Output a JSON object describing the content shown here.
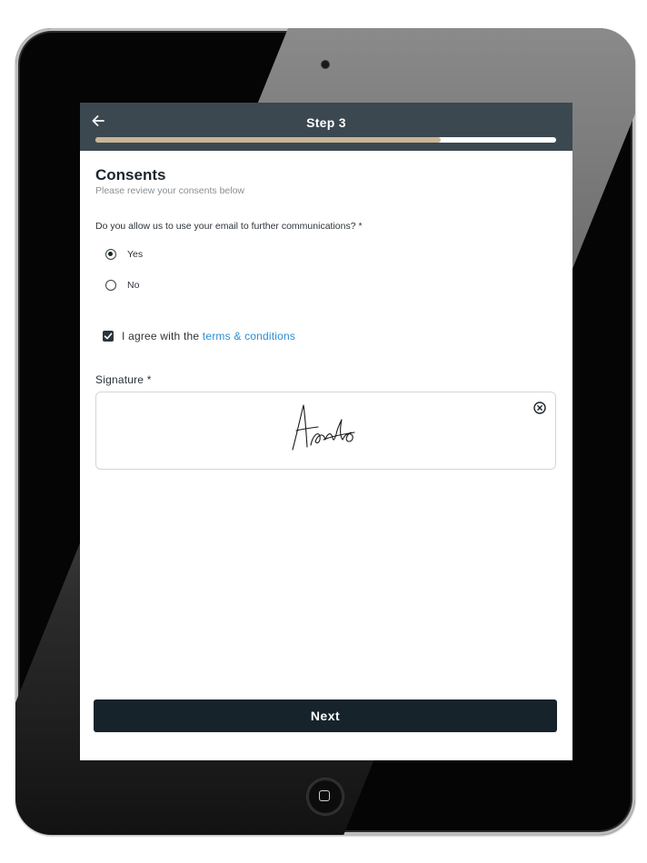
{
  "header": {
    "title": "Step 3",
    "progress_fraction": 0.75
  },
  "form": {
    "title": "Consents",
    "subtitle": "Please review your consents below",
    "question": "Do you allow us to use your email to further communications?",
    "required_mark": "*",
    "options": [
      {
        "label": "Yes",
        "selected": true
      },
      {
        "label": "No",
        "selected": false
      }
    ],
    "agree_prefix": "I agree with the ",
    "agree_link": "terms & conditions",
    "agree_checked": true,
    "signature_label": "Signature *"
  },
  "footer": {
    "next_label": "Next"
  },
  "icons": {
    "back": "arrow-left-icon",
    "clear_signature": "close-circle-icon",
    "check": "check-icon"
  },
  "colors": {
    "header_bg": "#3b4850",
    "progress_fill": "#c8b697",
    "link": "#2b8fd3",
    "button_bg": "#17232b"
  }
}
